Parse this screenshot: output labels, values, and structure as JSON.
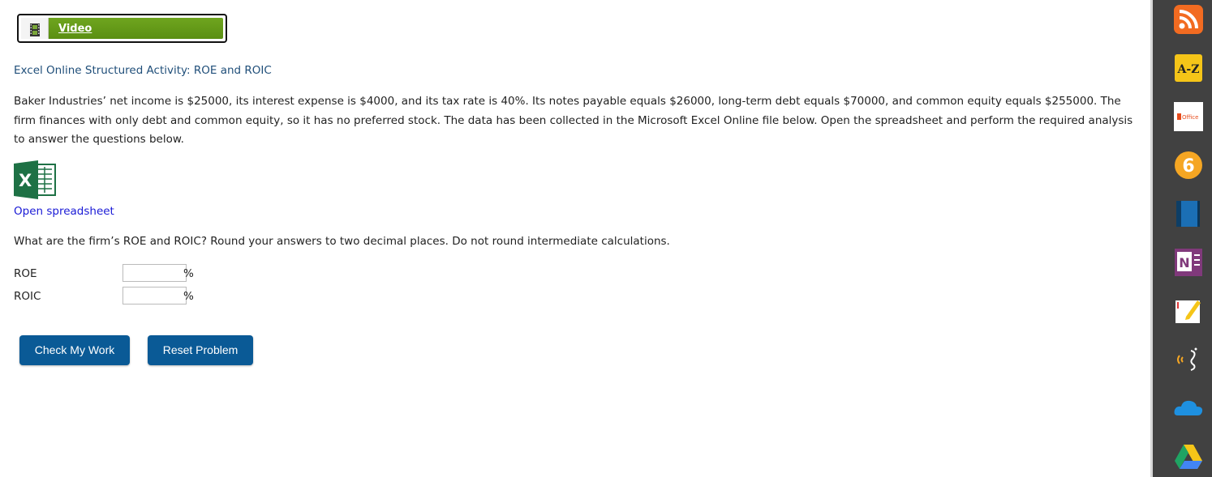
{
  "video": {
    "label": "Video"
  },
  "activity": {
    "title": "Excel Online Structured Activity: ROE and ROIC",
    "paragraph": "Baker Industries’ net income is $25000, its interest expense is $4000, and its tax rate is 40%. Its notes payable equals $26000, long-term debt equals $70000, and common equity equals $255000. The firm finances with only debt and common equity, so it has no preferred stock. The data has been collected in the Microsoft Excel Online file below. Open the spreadsheet and perform the required analysis to answer the questions below.",
    "open_spreadsheet": "Open spreadsheet",
    "question": "What are the firm’s ROE and ROIC? Round your answers to two decimal places. Do not round intermediate calculations."
  },
  "answers": {
    "roe": {
      "label": "ROE",
      "value": "",
      "unit": "%"
    },
    "roic": {
      "label": "ROIC",
      "value": "",
      "unit": "%"
    }
  },
  "buttons": {
    "check": "Check My Work",
    "reset": "Reset Problem"
  },
  "sidebar": {
    "items": [
      {
        "icon": "rss-icon"
      },
      {
        "icon": "a-z-icon",
        "label": "A-Z"
      },
      {
        "icon": "office-icon",
        "label": "Office"
      },
      {
        "icon": "six-circle-icon",
        "label": "6"
      },
      {
        "icon": "book-icon"
      },
      {
        "icon": "onenote-icon",
        "label": "N"
      },
      {
        "icon": "sticky-note-icon"
      },
      {
        "icon": "read-aloud-icon"
      },
      {
        "icon": "onedrive-icon"
      },
      {
        "icon": "google-drive-icon"
      }
    ]
  },
  "colors": {
    "video_green": "#6fa51f",
    "title_blue": "#1f4e79",
    "link_blue": "#1a1ad6",
    "button_blue": "#0a5a96",
    "sidebar_bg": "#414141"
  }
}
